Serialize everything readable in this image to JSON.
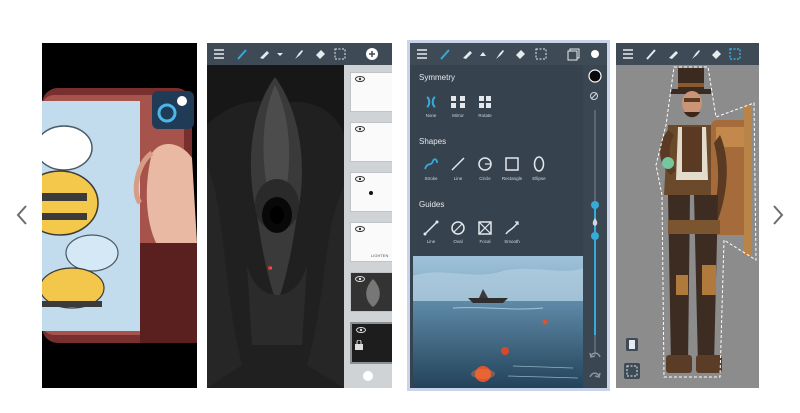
{
  "gallery": {
    "prev_label": "previous",
    "next_label": "next"
  },
  "screenshot2": {
    "layers": [
      "",
      "",
      "",
      "LIGHTEN",
      "",
      ""
    ]
  },
  "screenshot3": {
    "sections": {
      "symmetry": "Symmetry",
      "shapes": "Shapes",
      "guides": "Guides"
    },
    "symmetry_tools": [
      "None",
      "Mirror",
      "Rotate"
    ],
    "shape_tools": [
      "Stroke",
      "Line",
      "Circle",
      "Rectangle",
      "Ellipse"
    ],
    "guide_tools": [
      "Line",
      "Oval",
      "Focal",
      "Smooth"
    ]
  },
  "colors": {
    "toolbar": "#3e4a55",
    "panel": "#36434e",
    "accent": "#39a9d8",
    "selection_border": "#c9d3ec"
  }
}
